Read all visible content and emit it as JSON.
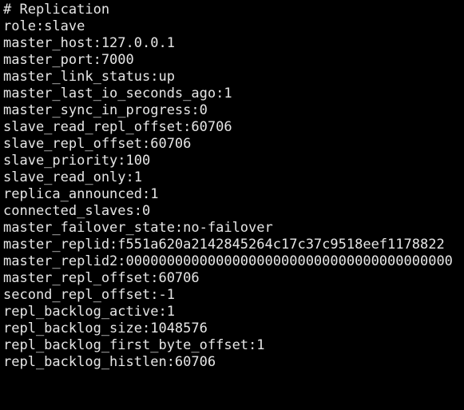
{
  "terminal": {
    "background_color": "#000000",
    "text_color": "#e6e6e6",
    "command_context": "redis INFO replication output",
    "lines": [
      {
        "text": "# Replication",
        "kind": "section-header"
      },
      {
        "text": "role:slave",
        "kind": "field"
      },
      {
        "text": "master_host:127.0.0.1",
        "kind": "field"
      },
      {
        "text": "master_port:7000",
        "kind": "field"
      },
      {
        "text": "master_link_status:up",
        "kind": "field"
      },
      {
        "text": "master_last_io_seconds_ago:1",
        "kind": "field"
      },
      {
        "text": "master_sync_in_progress:0",
        "kind": "field"
      },
      {
        "text": "slave_read_repl_offset:60706",
        "kind": "field"
      },
      {
        "text": "slave_repl_offset:60706",
        "kind": "field"
      },
      {
        "text": "slave_priority:100",
        "kind": "field"
      },
      {
        "text": "slave_read_only:1",
        "kind": "field"
      },
      {
        "text": "replica_announced:1",
        "kind": "field"
      },
      {
        "text": "connected_slaves:0",
        "kind": "field"
      },
      {
        "text": "master_failover_state:no-failover",
        "kind": "field"
      },
      {
        "text": "master_replid:f551a620a2142845264c17c37c9518eef1178822",
        "kind": "field"
      },
      {
        "text": "master_replid2:0000000000000000000000000000000000000000",
        "kind": "field"
      },
      {
        "text": "master_repl_offset:60706",
        "kind": "field"
      },
      {
        "text": "second_repl_offset:-1",
        "kind": "field"
      },
      {
        "text": "repl_backlog_active:1",
        "kind": "field"
      },
      {
        "text": "repl_backlog_size:1048576",
        "kind": "field"
      },
      {
        "text": "repl_backlog_first_byte_offset:1",
        "kind": "field"
      },
      {
        "text": "repl_backlog_histlen:60706",
        "kind": "field"
      }
    ]
  }
}
